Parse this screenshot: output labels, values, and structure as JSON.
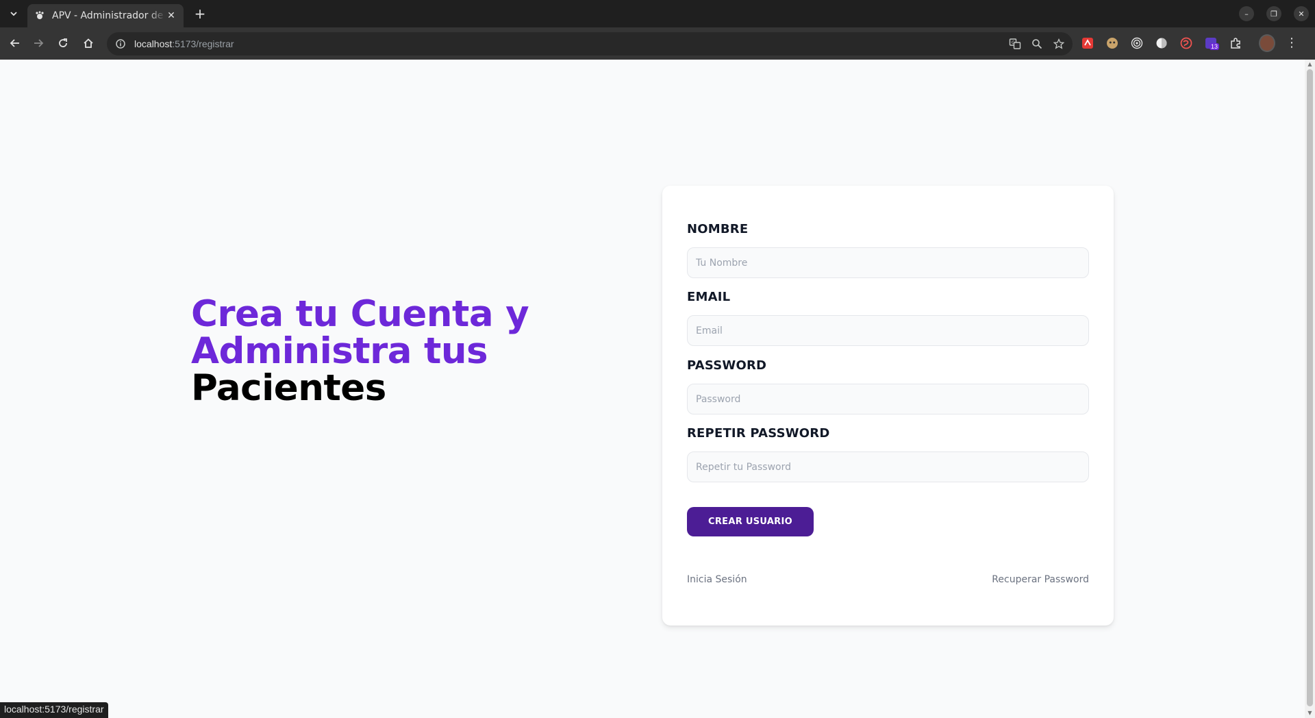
{
  "browser": {
    "tab_title": "APV - Administrador de Pacientes",
    "new_tab_label": "+",
    "url_host": "localhost",
    "url_path": ":5173/registrar",
    "extension_badge": "13",
    "status_url": "localhost:5173/registrar"
  },
  "hero": {
    "line_accent": "Crea tu Cuenta y Administra tus",
    "line_dark": "Pacientes"
  },
  "form": {
    "nombre": {
      "label": "NOMBRE",
      "placeholder": "Tu Nombre",
      "value": ""
    },
    "email": {
      "label": "EMAIL",
      "placeholder": "Email",
      "value": ""
    },
    "password": {
      "label": "PASSWORD",
      "placeholder": "Password",
      "value": ""
    },
    "repetir": {
      "label": "REPETIR PASSWORD",
      "placeholder": "Repetir tu Password",
      "value": ""
    },
    "submit_label": "CREAR USUARIO"
  },
  "links": {
    "login": "Inicia Sesión",
    "recover": "Recuperar Password"
  },
  "colors": {
    "accent": "#6d28d9",
    "button": "#4c1d95",
    "page_bg": "#f9fafb"
  }
}
